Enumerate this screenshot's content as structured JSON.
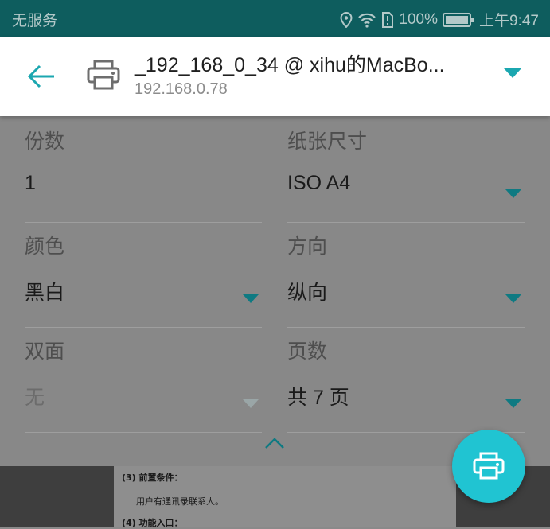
{
  "status_bar": {
    "carrier": "无服务",
    "battery_percent": "100%",
    "time": "上午9:47",
    "icons": [
      "location-icon",
      "wifi-icon",
      "sim-alert-icon",
      "battery-icon"
    ]
  },
  "header": {
    "printer_name": "_192_168_0_34 @ xihu的MacBo...",
    "printer_ip": "192.168.0.78",
    "icons": [
      "back-arrow-icon",
      "printer-icon",
      "dropdown-arrow-icon"
    ]
  },
  "options": {
    "copies": {
      "label": "份数",
      "value": "1"
    },
    "paper_size": {
      "label": "纸张尺寸",
      "value": "ISO A4"
    },
    "color": {
      "label": "颜色",
      "value": "黑白"
    },
    "orientation": {
      "label": "方向",
      "value": "纵向"
    },
    "duplex": {
      "label": "双面",
      "value": "无"
    },
    "pages": {
      "label": "页数",
      "value": "共 7 页"
    }
  },
  "preview": {
    "line1": "(3)    前置条件：",
    "line2": "用户有通讯录联系人。",
    "line3": "(4)    功能入口："
  },
  "colors": {
    "accent": "#1ba7b0",
    "fab": "#20c4d2",
    "status_bar": "#0e5d5e"
  }
}
